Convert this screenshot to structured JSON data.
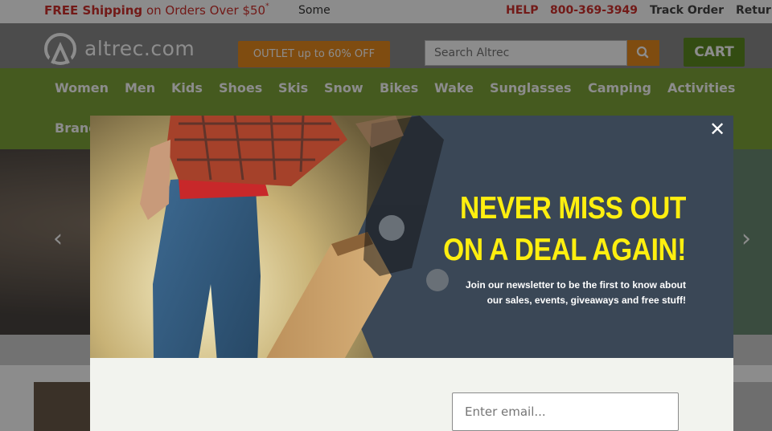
{
  "topbar": {
    "promo_bold": "FREE Shipping",
    "promo_rest": " on Orders Over $50",
    "promo_mark": "*",
    "some_text": "Some",
    "help": "HELP",
    "phone": "800-369-3949",
    "track_order": "Track Order",
    "returns": "Retur"
  },
  "header": {
    "logo_text": "altrec.com",
    "outlet_label": "OUTLET up to 60% OFF",
    "search_placeholder": "Search Altrec",
    "cart_label": "CART"
  },
  "nav": {
    "items": [
      "Women",
      "Men",
      "Kids",
      "Shoes",
      "Skis",
      "Snow",
      "Bikes",
      "Wake",
      "Sunglasses",
      "Camping",
      "Activities"
    ],
    "row2": [
      "Brand"
    ]
  },
  "modal": {
    "close_symbol": "✕",
    "headline_line1": "NEVER MISS OUT",
    "headline_line2": "ON A DEAL AGAIN!",
    "subtext_line1": "Join our newsletter to be the first to know about",
    "subtext_line2": "our sales, events, giveaways and free stuff!",
    "email_placeholder": "Enter email..."
  },
  "colors": {
    "promo_red": "#d0312d",
    "header_gray": "#8a8a8a",
    "outlet_orange": "#e88a1e",
    "cart_green": "#5e8a22",
    "nav_green": "#7fa43a",
    "modal_slate": "#3a4756",
    "headline_yellow": "#ffef0f"
  },
  "icons": {
    "logo": "altrec-logo-icon",
    "search": "search-icon",
    "close": "close-icon",
    "carousel_prev": "chevron-left-icon",
    "carousel_next": "chevron-right-icon"
  }
}
